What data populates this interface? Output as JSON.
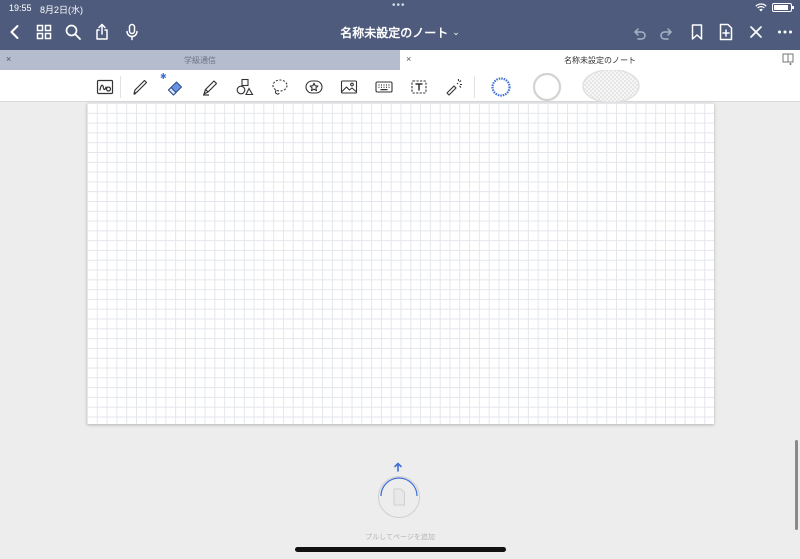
{
  "status": {
    "time": "19:55",
    "date": "8月2日(水)",
    "dots": "•••"
  },
  "header": {
    "title": "名称未設定のノート",
    "title_chevron": "⌄"
  },
  "tabs": [
    {
      "label": "学級通信",
      "active": false
    },
    {
      "label": "名称未設定のノート",
      "active": true
    }
  ],
  "tab_close_symbol": "×",
  "toolbar": {
    "bluetooth_symbol": "✱",
    "tools": [
      "pen-settings",
      "pen",
      "eraser",
      "highlighter",
      "shapes",
      "lasso",
      "elements",
      "image",
      "keyboard",
      "text",
      "laser-pointer"
    ],
    "colors": [
      "#3f6fd9",
      "#d8d8d8",
      "#e6e6e6"
    ]
  },
  "pull": {
    "label": "プルしてページを追加"
  },
  "accent": "#4e5b7c"
}
